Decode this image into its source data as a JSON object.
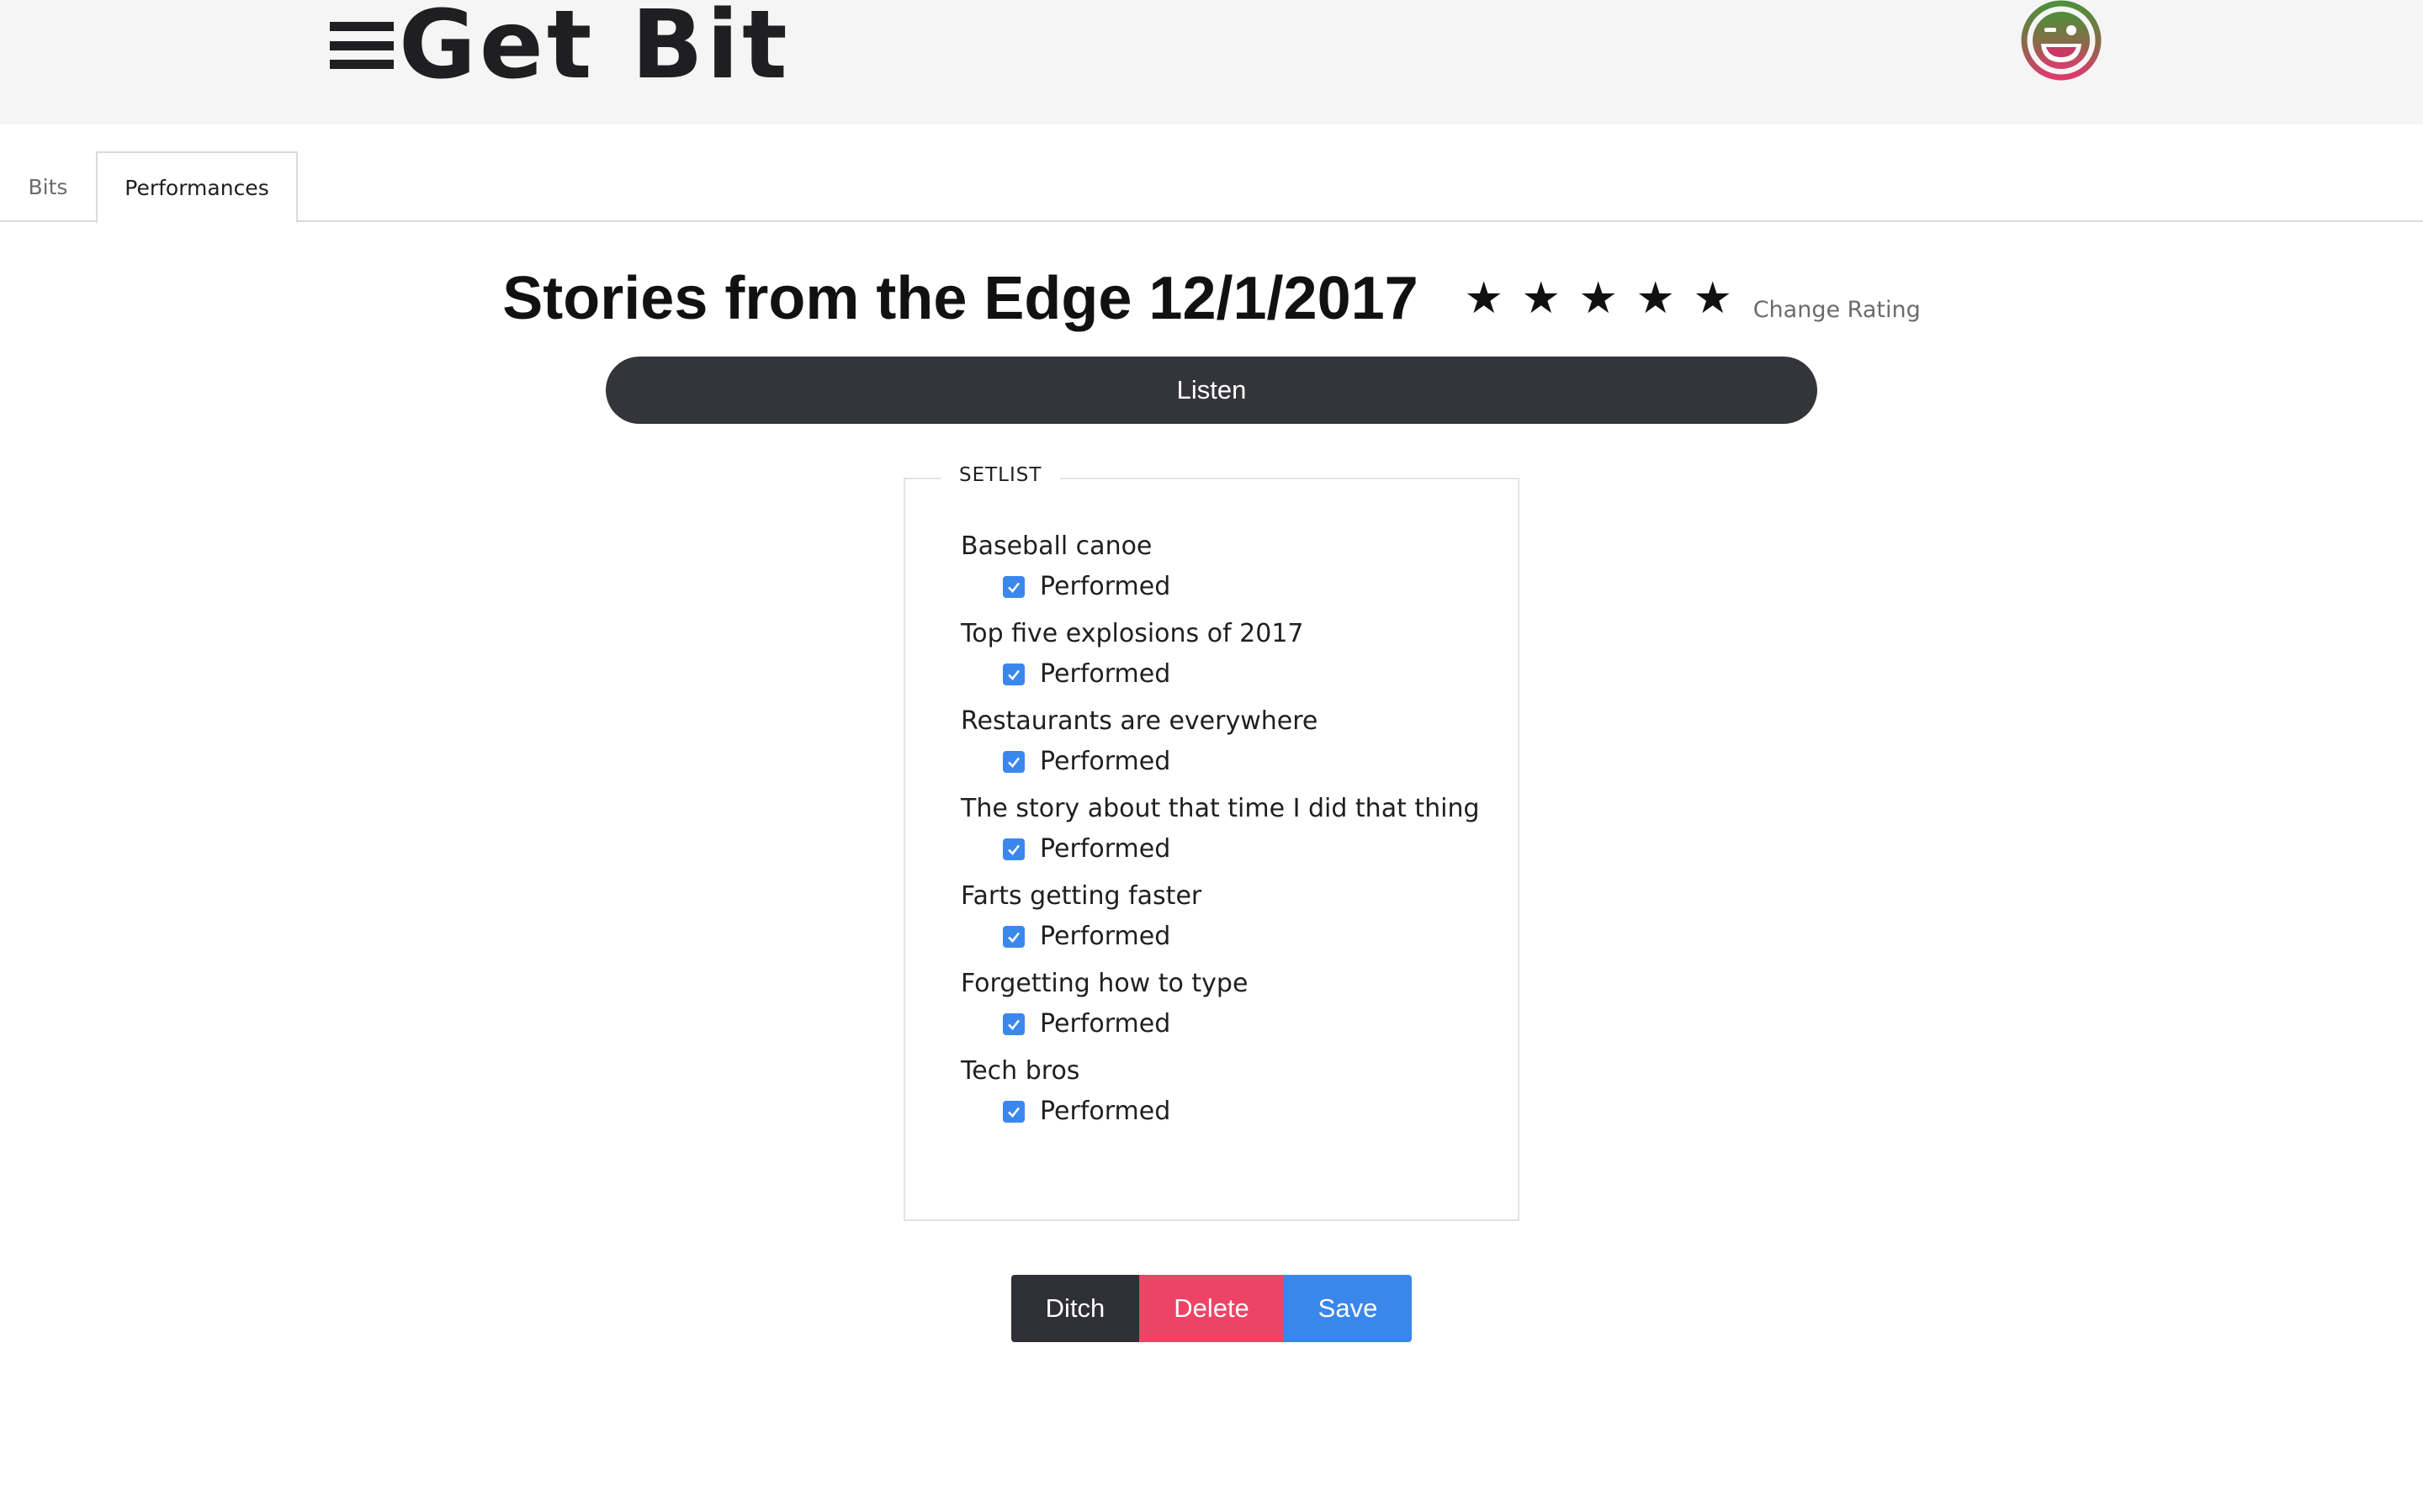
{
  "header": {
    "brand": "Get Bit",
    "menu_icon": "hamburger-menu-icon",
    "avatar_icon": "winking-face-icon"
  },
  "tabs": [
    {
      "label": "Bits",
      "active": false
    },
    {
      "label": "Performances",
      "active": true
    }
  ],
  "performance": {
    "title": "Stories from the Edge 12/1/2017",
    "rating": 5,
    "rating_max": 5,
    "star_glyph": "★",
    "change_rating_label": "Change Rating",
    "listen_label": "Listen"
  },
  "setlist": {
    "legend": "SETLIST",
    "checkbox_label": "Performed",
    "items": [
      {
        "name": "Baseball canoe",
        "performed": true
      },
      {
        "name": "Top five explosions of 2017",
        "performed": true
      },
      {
        "name": "Restaurants are everywhere",
        "performed": true
      },
      {
        "name": "The story about that time I did that thing",
        "performed": true
      },
      {
        "name": "Farts getting faster",
        "performed": true
      },
      {
        "name": "Forgetting how to type",
        "performed": true
      },
      {
        "name": "Tech bros",
        "performed": true
      }
    ]
  },
  "actions": {
    "ditch_label": "Ditch",
    "delete_label": "Delete",
    "save_label": "Save"
  },
  "colors": {
    "header_bg": "#f5f5f5",
    "dark": "#34353a",
    "delete": "#ed4466",
    "save": "#3a87ec",
    "checkbox": "#3b88ec",
    "avatar_top": "#5a9a3a",
    "avatar_bottom": "#d83a6a"
  }
}
